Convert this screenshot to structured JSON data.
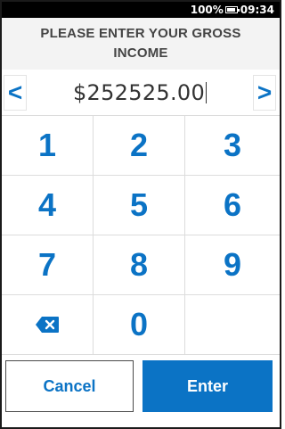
{
  "status_bar": {
    "battery_text": "100%",
    "time": "09:34"
  },
  "header": {
    "line1": "PLEASE ENTER YOUR GROSS",
    "line2": "INCOME"
  },
  "amount": {
    "value": "$252525.00",
    "left_arrow": "<",
    "right_arrow": ">"
  },
  "keypad": {
    "keys": [
      "1",
      "2",
      "3",
      "4",
      "5",
      "6",
      "7",
      "8",
      "9",
      "",
      "0",
      ""
    ],
    "backspace_icon": "backspace-icon"
  },
  "actions": {
    "cancel_label": "Cancel",
    "enter_label": "Enter"
  },
  "colors": {
    "accent": "#0b73c5"
  }
}
